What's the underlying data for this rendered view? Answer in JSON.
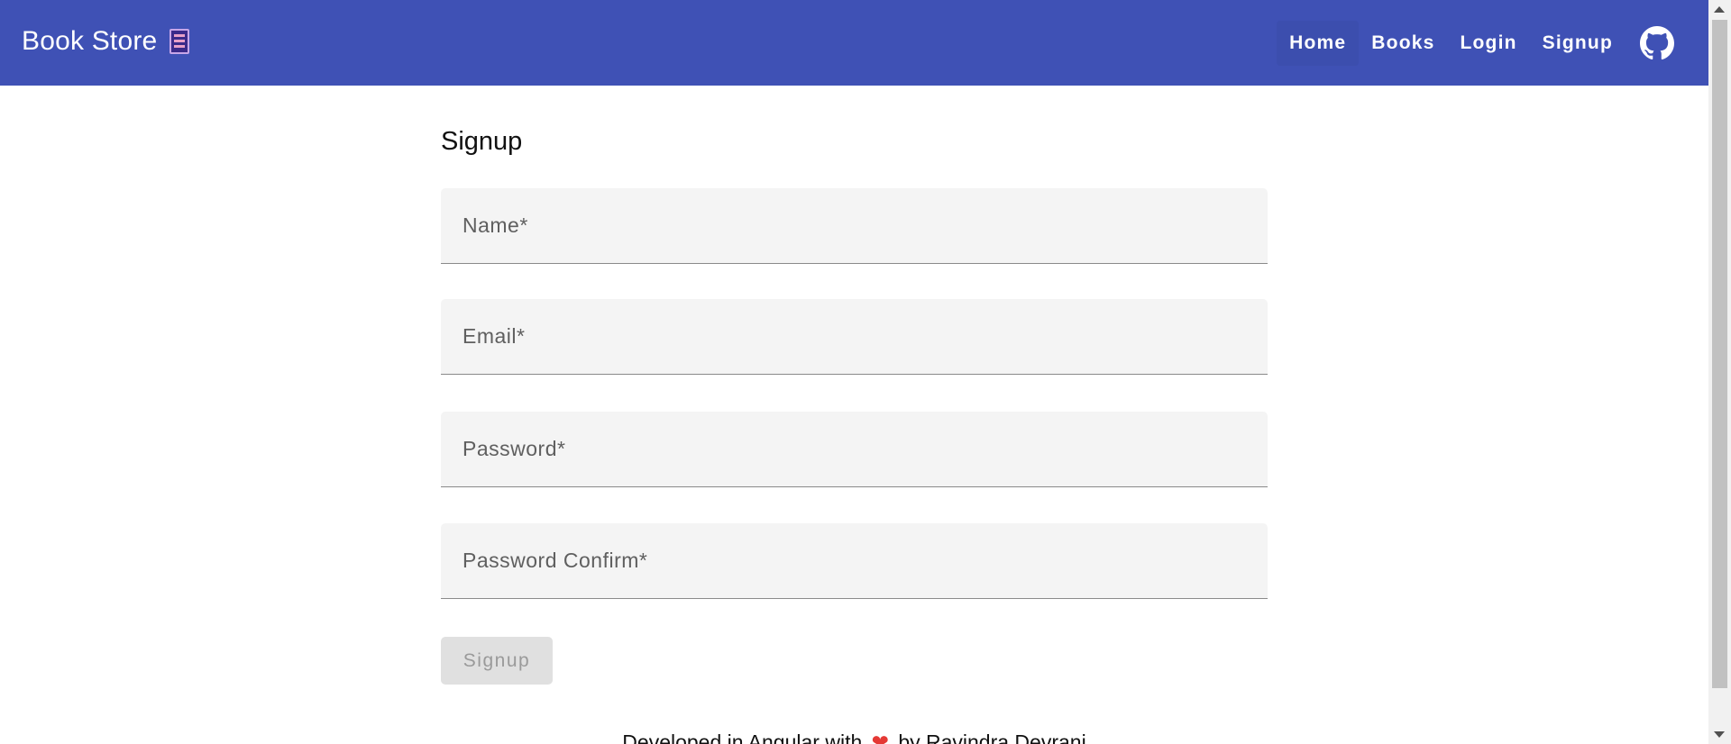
{
  "toolbar": {
    "title": "Book Store",
    "brand_icon": "book-icon",
    "nav": [
      {
        "label": "Home",
        "active": true
      },
      {
        "label": "Books"
      },
      {
        "label": "Login"
      },
      {
        "label": "Signup"
      }
    ],
    "github_icon": "github-icon",
    "color": "#3f51b5"
  },
  "form": {
    "heading": "Signup",
    "fields": {
      "name": {
        "label": "Name*",
        "value": ""
      },
      "email": {
        "label": "Email*",
        "value": ""
      },
      "password": {
        "label": "Password*",
        "value": ""
      },
      "password_confirm": {
        "label": "Password Confirm*",
        "value": ""
      }
    },
    "submit_label": "Signup",
    "submit_disabled": true
  },
  "footer": {
    "prefix": "Developed in Angular with",
    "heart_icon": "heart-icon",
    "suffix": "by Ravindra Devrani"
  }
}
